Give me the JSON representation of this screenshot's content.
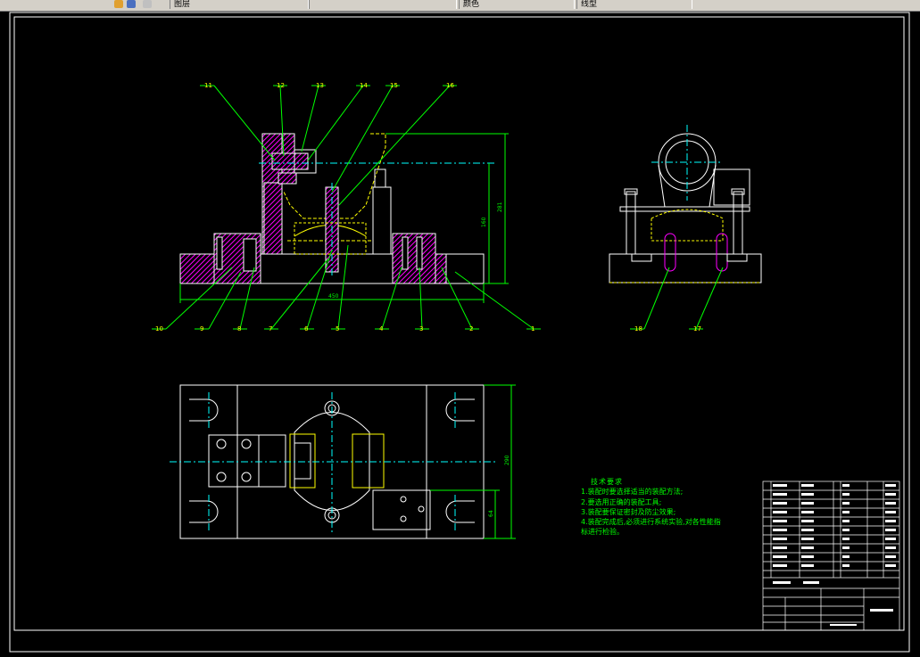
{
  "toolbar": {
    "segments": [
      "图层",
      "",
      "颜色",
      "线型"
    ]
  },
  "technical_requirements": {
    "title": "技术要求",
    "lines": [
      "1.装配时要选择适当的装配方法;",
      "2.要选用正确的装配工具;",
      "3.装配要保证密封及防尘效果;",
      "4.装配完成后,必须进行系统实验,对各性能指",
      "标进行检验。"
    ]
  },
  "balloons": {
    "top": [
      "11",
      "12",
      "13",
      "14",
      "15",
      "16"
    ],
    "bottom": [
      "10",
      "9",
      "8",
      "7",
      "6",
      "5",
      "4",
      "3",
      "2",
      "1"
    ],
    "side": [
      "18",
      "17"
    ]
  },
  "dimensions": {
    "front_height_outer": "281",
    "front_height_inner": "160",
    "front_width": "450",
    "plan_height": "290",
    "plan_offset": "64"
  },
  "colors": {
    "background": "#000000",
    "outline": "#ffffff",
    "leader": "#00ff00",
    "centerline": "#00ffff",
    "hatch": "#ff00ff",
    "hidden": "#ffff00"
  }
}
